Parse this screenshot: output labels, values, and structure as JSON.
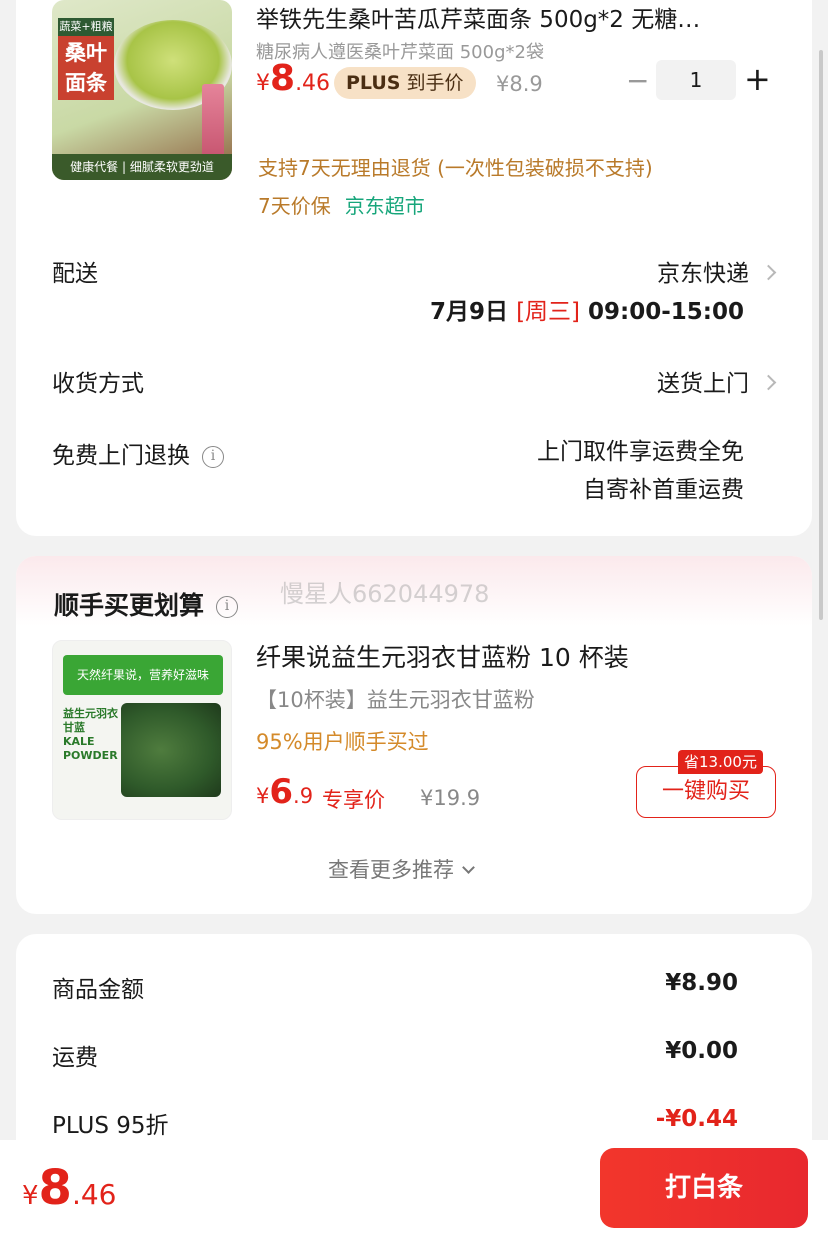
{
  "product": {
    "title": "举铁先生桑叶苦瓜芹菜面条 500g*2 无糖…",
    "subtitle": "糖尿病人遵医桑叶芹菜面 500g*2袋",
    "price_currency": "¥",
    "price_int": "8",
    "price_dec": ".46",
    "plus_badge_plus": "PLUS",
    "plus_badge_text": " 到手价",
    "original_price": "¥8.9",
    "quantity_minus": "−",
    "quantity": "1",
    "quantity_plus": "+",
    "service_line1": "支持7天无理由退货 (一次性包装破损不支持)",
    "service_price_protect": "7天价保",
    "service_store": "京东超市",
    "image_text": {
      "tag_top": "蔬菜+粗粮",
      "tag_main": "桑叶面条",
      "tag_bottom": "健康代餐 | 细腻柔软更劲道"
    }
  },
  "delivery": {
    "label": "配送",
    "method": "京东快递",
    "date": "7月9日",
    "weekday": "[周三]",
    "time": "09:00-15:00"
  },
  "receive": {
    "label": "收货方式",
    "value": "送货上门"
  },
  "return_service": {
    "label": "免费上门退换",
    "info_icon": "i",
    "line1": "上门取件享运费全免",
    "line2": "自寄补首重运费"
  },
  "recommend": {
    "section_title": "顺手买更划算",
    "info_icon": "i",
    "watermark": "慢星人662044978",
    "item": {
      "title": "纤果说益生元羽衣甘蓝粉 10 杯装",
      "subtitle": "【10杯装】益生元羽衣甘蓝粉",
      "bought_pct": "95%用户顺手买过",
      "price_currency": "¥",
      "price_int": "6",
      "price_dec": ".9",
      "price_label": "专享价",
      "original_price": "¥19.9",
      "save_tag": "省13.00元",
      "buy_button": "一键购买",
      "image_text": {
        "band": "天然纤果说，营养好滋味",
        "name": "益生元羽衣甘蓝 KALE POWDER"
      }
    },
    "more_link": "查看更多推荐"
  },
  "summary": {
    "rows": [
      {
        "label": "商品金额",
        "value": "¥8.90"
      },
      {
        "label": "运费",
        "value": "¥0.00"
      },
      {
        "label": "PLUS 95折",
        "value": "-¥0.44"
      }
    ]
  },
  "bottom": {
    "total_currency": "¥",
    "total_int": "8",
    "total_dec": ".46",
    "pay_button": "打白条"
  },
  "colors": {
    "accent_red": "#e2231a",
    "service_orange": "#b97a2a",
    "store_green": "#17a67b"
  }
}
